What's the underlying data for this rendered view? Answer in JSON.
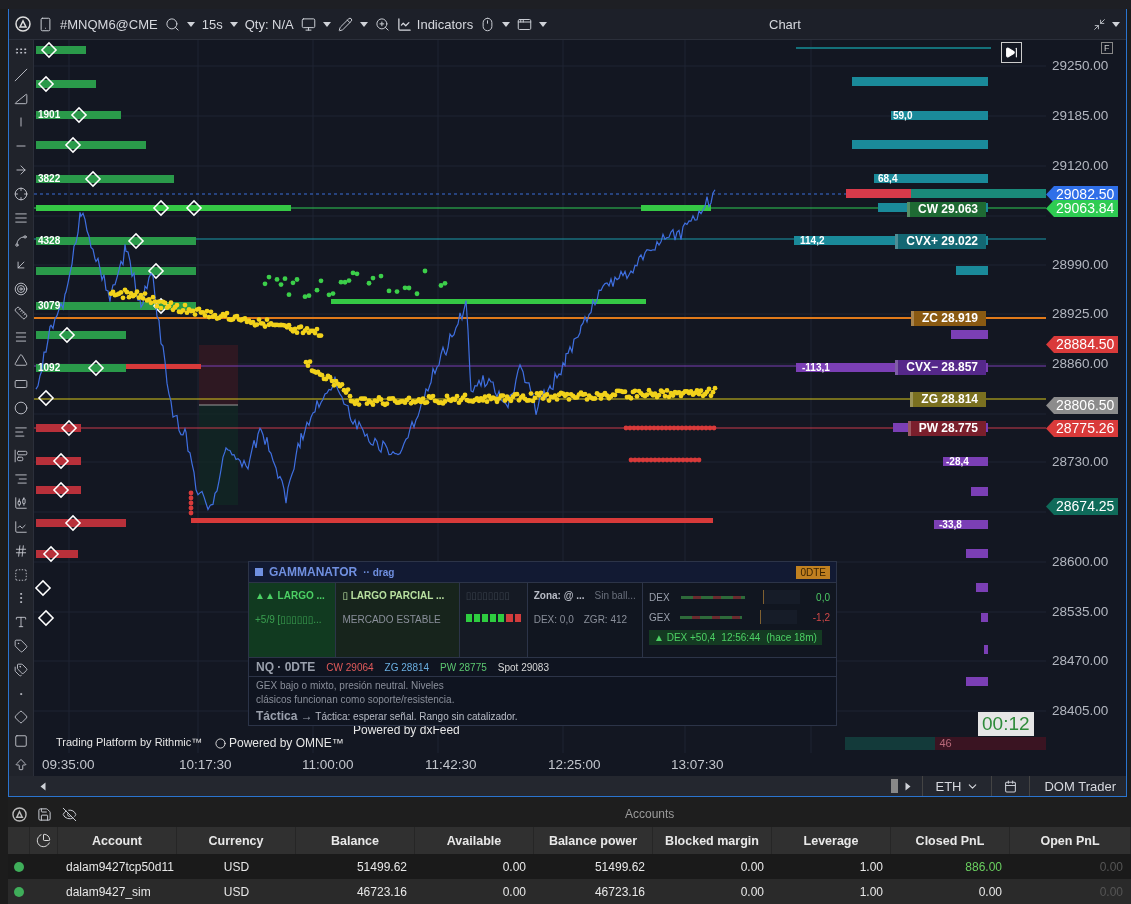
{
  "toolbar": {
    "symbol": "#MNQM6@CME",
    "interval": "15s",
    "qty": "Qty: N/A",
    "indicators": "Indicators",
    "title": "Chart"
  },
  "chart": {
    "price_ticks": [
      "29250.00",
      "29185.00",
      "29120.00",
      "28990.00",
      "28925.00",
      "28860.00",
      "28730.00",
      "28600.00",
      "28535.00",
      "28470.00",
      "28405.00"
    ],
    "price_tags": [
      {
        "text": "29082.50",
        "color": "#2f6fe8"
      },
      {
        "text": "29063.84",
        "color": "#2ecc52"
      },
      {
        "text": "28884.50",
        "color": "#d93a3a"
      },
      {
        "text": "28806.50",
        "color": "#8c8c8c"
      },
      {
        "text": "28775.26",
        "color": "#d93a3a"
      },
      {
        "text": "28674.25",
        "color": "#0f6b5a"
      }
    ],
    "time_ticks": [
      "09:35:00",
      "10:17:30",
      "11:00:00",
      "11:42:30",
      "12:25:00",
      "13:07:30"
    ],
    "volume_labels": [
      "1901",
      "3822",
      "4328",
      "3079",
      "1092"
    ],
    "level_labels": [
      {
        "text": "CW 29.063",
        "color": "#1e6a33"
      },
      {
        "text": "CVX+ 29.022",
        "color": "#136773"
      },
      {
        "text": "ZC 28.919",
        "color": "#8a5a12"
      },
      {
        "text": "CVX− 28.857",
        "color": "#55288a"
      },
      {
        "text": "ZG 28.814",
        "color": "#7a7020"
      },
      {
        "text": "PW 28.775",
        "color": "#7a1f2c"
      }
    ],
    "bar_values": [
      "59,0",
      "68,4",
      "114,2",
      "-113,1",
      "-28,4",
      "-33,8"
    ],
    "timer": "00:12",
    "counter": "46",
    "scale_mode": "F",
    "credits": [
      "Trading Platform by Rithmic™",
      "Powered by OMNE™",
      "Powered by dxFeed"
    ]
  },
  "gammanator": {
    "title": "GAMMANATOR",
    "handle": "·· drag",
    "badge": "0DTE",
    "signal": {
      "label": "▲▲ LARGO ...",
      "score": "+5/9  [▯▯▯▯▯▯..."
    },
    "status": {
      "label": "▯ LARGO PARCIAL ...",
      "state": "MERCADO ESTABLE"
    },
    "strength": {
      "glyphs": "▯▯▯▯▯▯▯▯",
      "blocks": [
        {
          "color": "#2ecc40"
        },
        {
          "color": "#2ecc40"
        },
        {
          "color": "#2ecc40"
        },
        {
          "color": "#2ecc40"
        },
        {
          "color": "#2ecc40"
        },
        {
          "color": "#d23c3c"
        },
        {
          "color": "#d23c3c"
        }
      ]
    },
    "zone": {
      "label": "Zona: @ ...",
      "ball": "Sin ball...",
      "dex": "DEX: 0,0",
      "zgr": "ZGR: 412"
    },
    "meters": [
      {
        "label": "DEX",
        "value": "0,0",
        "negative": false
      },
      {
        "label": "GEX",
        "value": "-1,2",
        "negative": true
      }
    ],
    "alert": [
      "▲ DEX +50,4",
      "12:56:44",
      "(hace 18m)"
    ],
    "summary": {
      "title": "NQ · 0DTE",
      "items": [
        {
          "text": "CW 29064",
          "color": "#e05a5a"
        },
        {
          "text": "ZG 28814",
          "color": "#6aaee0"
        },
        {
          "text": "PW 28775",
          "color": "#5cc870"
        },
        {
          "text": "Spot 29083",
          "color": "#d8d8d8"
        }
      ]
    },
    "description": "GEX bajo o mixto, presión neutral. Niveles clásicos funcionan como soporte/resistencia.",
    "tactic": "**Táctica →** Táctica: esperar señal. Rango sin catalizador."
  },
  "bottom_bar": {
    "session": "ETH",
    "dom": "DOM Trader"
  },
  "accounts": {
    "title": "Accounts",
    "columns": [
      "Account",
      "Currency",
      "Balance",
      "Available",
      "Balance power",
      "Blocked margin",
      "Leverage",
      "Closed PnL",
      "Open PnL"
    ],
    "rows": [
      {
        "connected": true,
        "cells": [
          "dalam9427tcp50d11",
          "USD",
          "51499.62",
          "0.00",
          "51499.62",
          "0.00",
          "1.00",
          "886.00",
          "0.00"
        ],
        "pnl_positive": true
      },
      {
        "connected": true,
        "cells": [
          "dalam9427_sim",
          "USD",
          "46723.16",
          "0.00",
          "46723.16",
          "0.00",
          "1.00",
          "0.00",
          "0.00"
        ],
        "pnl_positive": false
      }
    ]
  }
}
